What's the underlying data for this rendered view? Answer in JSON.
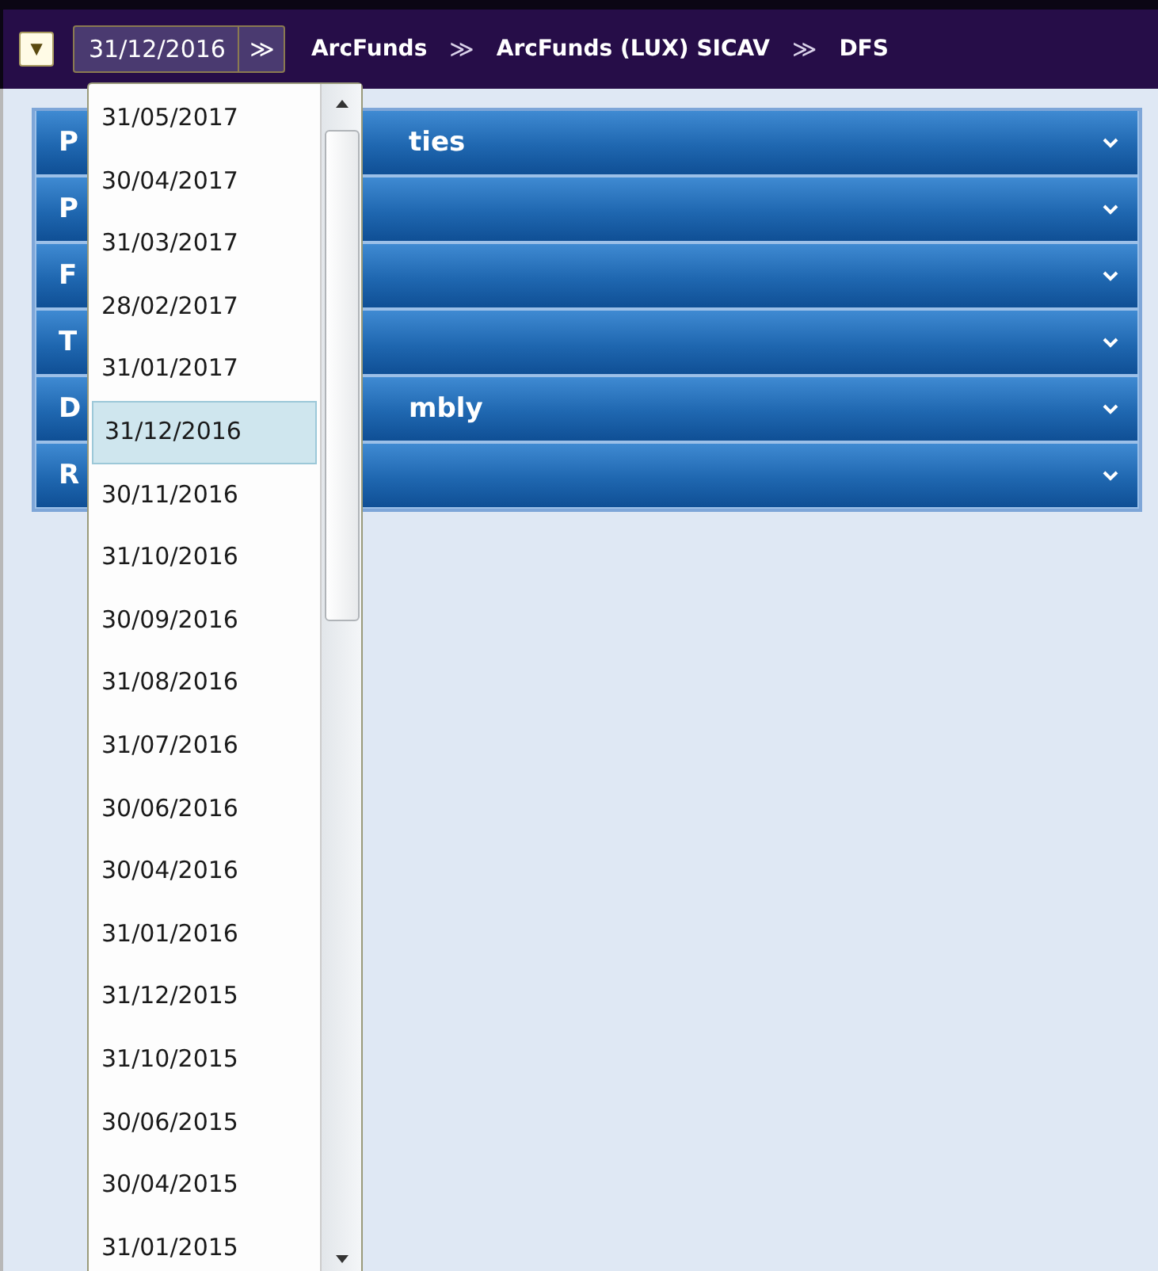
{
  "toolbar": {
    "toggle": "▼",
    "date_field": {
      "value": "31/12/2016",
      "expander": "≫"
    },
    "breadcrumbs": [
      {
        "label": "ArcFunds",
        "separator": "≫"
      },
      {
        "label": "ArcFunds (LUX) SICAV",
        "separator": "≫"
      },
      {
        "label": "DFS"
      }
    ]
  },
  "sections": [
    {
      "lead": "P",
      "tail": "ties",
      "expanded": false
    },
    {
      "lead": "P",
      "expanded": false
    },
    {
      "lead": "F",
      "expanded": false
    },
    {
      "lead": "T",
      "expanded": false
    },
    {
      "lead": "D",
      "tail": "mbly",
      "expanded": false
    },
    {
      "lead": "R",
      "expanded": false
    }
  ],
  "date_dropdown": {
    "options": [
      {
        "label": "31/05/2017",
        "selected": false
      },
      {
        "label": "30/04/2017",
        "selected": false
      },
      {
        "label": "31/03/2017",
        "selected": false
      },
      {
        "label": "28/02/2017",
        "selected": false
      },
      {
        "label": "31/01/2017",
        "selected": false
      },
      {
        "label": "31/12/2016",
        "selected": true
      },
      {
        "label": "30/11/2016",
        "selected": false
      },
      {
        "label": "31/10/2016",
        "selected": false
      },
      {
        "label": "30/09/2016",
        "selected": false
      },
      {
        "label": "31/08/2016",
        "selected": false
      },
      {
        "label": "31/07/2016",
        "selected": false
      },
      {
        "label": "30/06/2016",
        "selected": false
      },
      {
        "label": "30/04/2016",
        "selected": false
      },
      {
        "label": "31/01/2016",
        "selected": false
      },
      {
        "label": "31/12/2015",
        "selected": false
      },
      {
        "label": "31/10/2015",
        "selected": false
      },
      {
        "label": "30/06/2015",
        "selected": false
      },
      {
        "label": "30/04/2015",
        "selected": false
      },
      {
        "label": "31/01/2015",
        "selected": false
      }
    ]
  }
}
